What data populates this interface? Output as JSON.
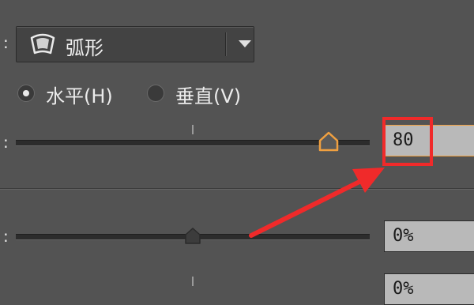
{
  "warp_style": {
    "selected": "弧形",
    "icon": "arc-warp-icon"
  },
  "orientation": {
    "options": [
      {
        "label": "水平(H)",
        "checked": true
      },
      {
        "label": "垂直(V)",
        "checked": false
      }
    ]
  },
  "bend": {
    "value": "80",
    "slider_percent": 90
  },
  "horizontal_distortion": {
    "value": "0%",
    "slider_percent": 50
  },
  "vertical_distortion": {
    "value": "0%",
    "slider_percent": 50
  },
  "colors": {
    "annotation": "#f02a2a",
    "highlight": "#f0a040"
  }
}
